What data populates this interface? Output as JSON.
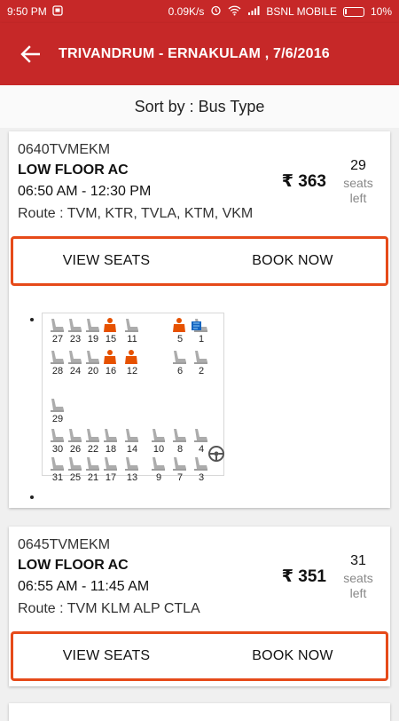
{
  "status": {
    "time": "9:50 PM",
    "speed": "0.09K/s",
    "carrier": "BSNL MOBILE",
    "battery": "10%"
  },
  "header": {
    "title": "TRIVANDRUM - ERNAKULAM , 7/6/2016"
  },
  "sort": {
    "label": "Sort by : Bus Type"
  },
  "buses": [
    {
      "code": "0640TVMEKM",
      "type": "LOW FLOOR AC",
      "time": "06:50 AM - 12:30 PM",
      "route": "Route :  TVM, KTR, TVLA, KTM, VKM",
      "price": "₹ 363",
      "seats_count": "29",
      "seats_label_1": "seats",
      "seats_label_2": "left",
      "view_label": "VIEW SEATS",
      "book_label": "BOOK NOW"
    },
    {
      "code": "0645TVMEKM",
      "type": "LOW FLOOR AC",
      "time": "06:55 AM - 11:45 AM",
      "route": "Route :  TVM KLM ALP CTLA",
      "price": "₹ 351",
      "seats_count": "31",
      "seats_label_1": "seats",
      "seats_label_2": "left",
      "view_label": "VIEW SEATS",
      "book_label": "BOOK NOW"
    }
  ],
  "seatmap": {
    "colors": {
      "available": "#9e9e9e",
      "booked": "#e65100",
      "steering": "#555555"
    },
    "rows": [
      {
        "seats": [
          "27",
          "23",
          "19",
          "15",
          "11",
          "5",
          "1"
        ],
        "booked": [
          "15",
          "5"
        ]
      },
      {
        "seats": [
          "28",
          "24",
          "20",
          "16",
          "12",
          "6",
          "2"
        ],
        "booked": [
          "16",
          "12"
        ]
      },
      {
        "seats": [
          "29"
        ],
        "booked": []
      },
      {
        "seats": [
          "30",
          "26",
          "22",
          "18",
          "14",
          "10",
          "8",
          "4"
        ],
        "booked": []
      },
      {
        "seats": [
          "31",
          "25",
          "21",
          "17",
          "13",
          "9",
          "7",
          "3"
        ],
        "booked": []
      }
    ]
  }
}
